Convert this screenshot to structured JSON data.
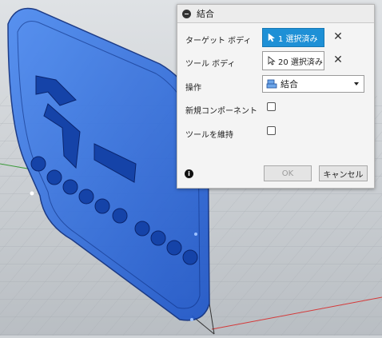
{
  "dialog": {
    "title": "結合",
    "rows": {
      "target": {
        "label": "ターゲット ボディ",
        "value": "1 選択済み"
      },
      "tool": {
        "label": "ツール ボディ",
        "value": "20 選択済み"
      },
      "operation": {
        "label": "操作",
        "value": "結合"
      },
      "new_component": {
        "label": "新規コンポーネント",
        "checked": false
      },
      "keep_tools": {
        "label": "ツールを維持",
        "checked": false
      }
    },
    "ok_label": "OK",
    "cancel_label": "キャンセル"
  },
  "colors": {
    "selection_blue": "#1e90d6",
    "model_blue": "#2f6fe0"
  },
  "icons": {
    "collapse": "minus-circle-icon",
    "cursor": "pointer-icon",
    "clear": "close-icon",
    "operation": "join-icon",
    "info": "info-icon"
  }
}
